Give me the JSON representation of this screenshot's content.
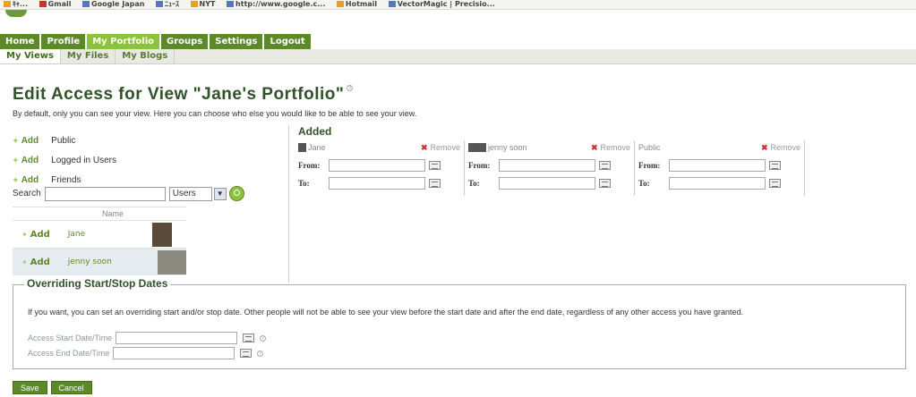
{
  "browser": {
    "bookmarks": [
      {
        "label": "ｷｬ...",
        "icon": "feed-icon"
      },
      {
        "label": "Gmail",
        "icon": "gmail-icon"
      },
      {
        "label": "Google Japan",
        "icon": "google-icon"
      },
      {
        "label": "ﾆｭｰｽ",
        "icon": "news-icon"
      },
      {
        "label": "NYT",
        "icon": "nyt-icon"
      },
      {
        "label": "http://www.google.c...",
        "icon": "google-icon"
      },
      {
        "label": "Hotmail",
        "icon": "hotmail-icon"
      },
      {
        "label": "VectorMagic | Precisio...",
        "icon": "bookmark-icon"
      }
    ]
  },
  "nav": {
    "tabs": [
      "Home",
      "Profile",
      "My Portfolio",
      "Groups",
      "Settings",
      "Logout"
    ],
    "active": "My Portfolio"
  },
  "subnav": {
    "tabs": [
      "My Views",
      "My Files",
      "My Blogs"
    ],
    "active": "My Views"
  },
  "page": {
    "title": "Edit Access for View \"Jane's Portfolio\"",
    "intro": "By default, only you can see your view. Here you can choose who else you would like to be able to see your view."
  },
  "left": {
    "add_label": "Add",
    "options": [
      "Public",
      "Logged in Users",
      "Friends"
    ],
    "search_label": "Search",
    "search_value": "",
    "select_value": "Users",
    "table_header": "Name",
    "users": [
      {
        "name": "Jane"
      },
      {
        "name": "jenny soon"
      }
    ]
  },
  "added": {
    "title": "Added",
    "remove_label": "Remove",
    "from_label": "From:",
    "to_label": "To:",
    "entries": [
      {
        "name": "Jane",
        "icon": "user-icon"
      },
      {
        "name": "jenny soon",
        "icon": "user-icon"
      },
      {
        "name": "Public",
        "icon": ""
      }
    ]
  },
  "override": {
    "title": "Overriding Start/Stop Dates",
    "text": "If you want, you can set an overriding start and/or stop date. Other people will not be able to see your view before the start date and after the end date, regardless of any other access you have granted.",
    "start_label": "Access Start Date/Time",
    "end_label": "Access End Date/Time"
  },
  "buttons": {
    "save": "Save",
    "cancel": "Cancel"
  },
  "colors": {
    "brand_green": "#5c8a28",
    "active_tab": "#8bc43c",
    "title_green": "#30512a"
  }
}
